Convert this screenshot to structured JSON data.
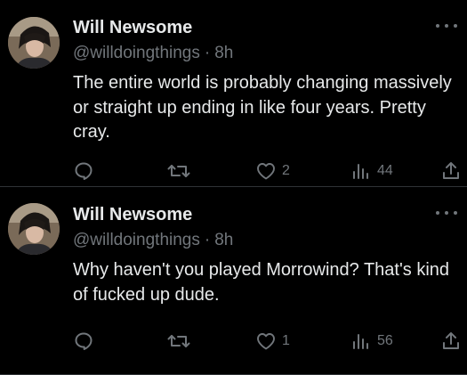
{
  "tweets": [
    {
      "display_name": "Will Newsome",
      "handle": "@willdoingthings",
      "separator": "·",
      "time": "8h",
      "text": "The entire world is probably changing massively or straight up ending in like four years. Pretty cray.",
      "actions": {
        "reply_icon": "reply-icon",
        "retweet_icon": "retweet-icon",
        "like_icon": "heart-icon",
        "like_count": "2",
        "views_icon": "views-icon",
        "views_count": "44",
        "share_icon": "share-icon"
      }
    },
    {
      "display_name": "Will Newsome",
      "handle": "@willdoingthings",
      "separator": "·",
      "time": "8h",
      "text": "Why haven't you played Morrowind? That's kind of fucked up dude.",
      "actions": {
        "reply_icon": "reply-icon",
        "retweet_icon": "retweet-icon",
        "like_icon": "heart-icon",
        "like_count": "1",
        "views_icon": "views-icon",
        "views_count": "56",
        "share_icon": "share-icon"
      }
    }
  ],
  "colors": {
    "background": "#000000",
    "primary_text": "#e7e9ea",
    "secondary_text": "#71767b",
    "divider": "#2f3336"
  }
}
